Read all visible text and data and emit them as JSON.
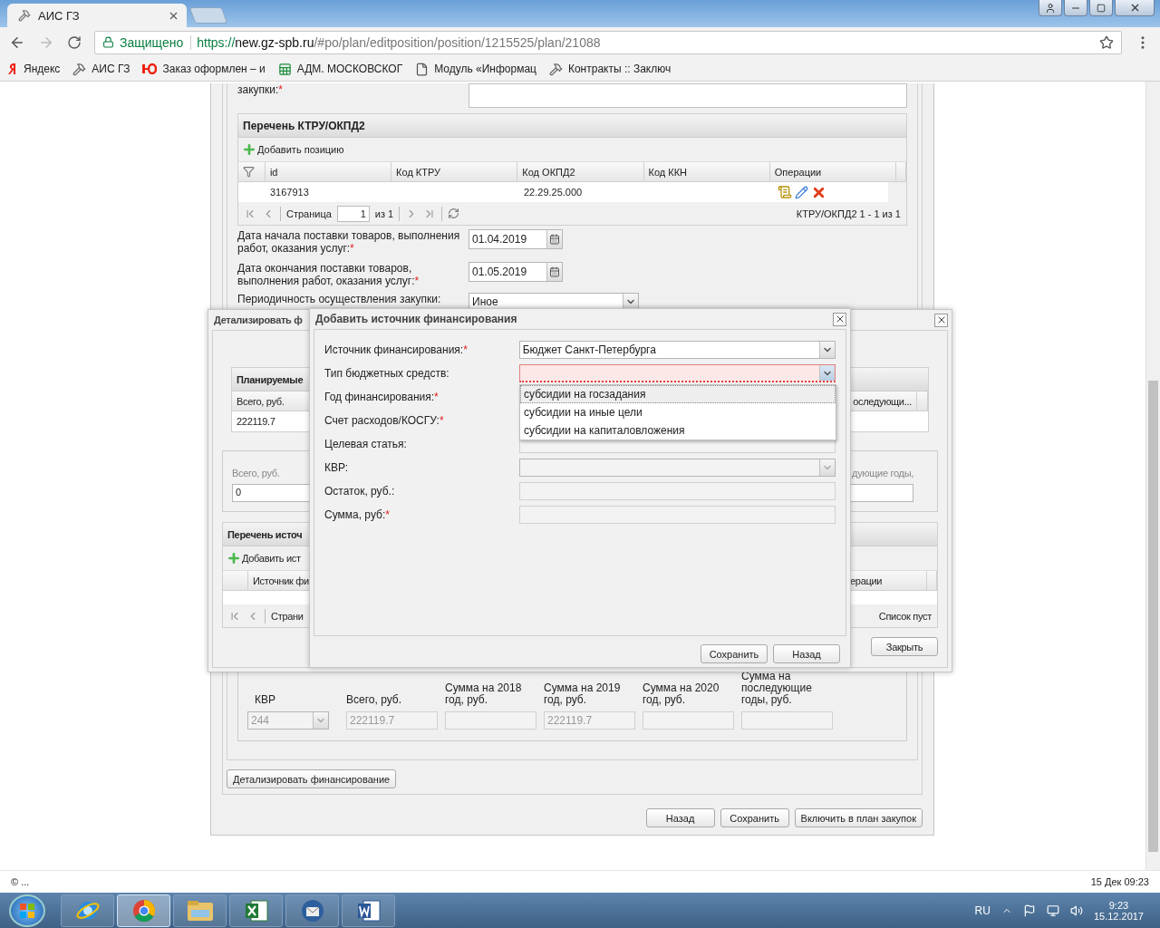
{
  "browser": {
    "tab": {
      "title": "АИС ГЗ"
    },
    "security": "Защищено",
    "url": {
      "scheme": "https://",
      "host": "new.gz-spb.ru",
      "path": "/#po/plan/editposition/position/1215525/plan/21088"
    },
    "bookmarks": [
      {
        "label": "Яндекс",
        "kind": "yandex"
      },
      {
        "label": "АИС ГЗ",
        "kind": "hammer"
      },
      {
        "label": "Заказ оформлен – и",
        "kind": "yu"
      },
      {
        "label": "АДМ. МОСКОВСКОГ",
        "kind": "sheet"
      },
      {
        "label": "Модуль «Информац",
        "kind": "doc"
      },
      {
        "label": "Контракты :: Заключ",
        "kind": "hammer"
      }
    ]
  },
  "form": {
    "purchase_field": {
      "label": "закупки:",
      "asterisk": "*"
    },
    "ktru_grid": {
      "title": "Перечень КТРУ/ОКПД2",
      "add_button": "Добавить позицию",
      "columns": [
        "id",
        "Код КТРУ",
        "Код ОКПД2",
        "Код ККН",
        "Операции"
      ],
      "rows": [
        {
          "id": "3167913",
          "okpd2": "22.29.25.000"
        }
      ],
      "pager": {
        "page_label": "Страница",
        "page": "1",
        "of": "из 1",
        "summary": "КТРУ/ОКПД2 1 - 1 из 1"
      }
    },
    "dates": [
      {
        "label": "Дата начала поставки товаров, выполнения работ, оказания услуг:",
        "asterisk": "*",
        "value": "01.04.2019"
      },
      {
        "label": "Дата окончания поставки товаров, выполнения работ, оказания услуг:",
        "asterisk": "*",
        "value": "01.05.2019"
      }
    ],
    "periodicity": {
      "label": "Периодичность осуществления закупки:",
      "value": "Иное"
    },
    "kvr_fields": [
      {
        "label": "КВР",
        "value": "244",
        "kind": "select",
        "disabled": true
      },
      {
        "label": "Всего, руб.",
        "value": "222119.7",
        "kind": "text",
        "disabled": true
      },
      {
        "label": "Сумма на 2018 год, руб.",
        "kind": "text",
        "disabled": true
      },
      {
        "label": "Сумма на 2019 год, руб.",
        "value": "222119.7",
        "kind": "text",
        "disabled": true
      },
      {
        "label": "Сумма на 2020 год, руб.",
        "kind": "text",
        "disabled": true
      },
      {
        "label": "Сумма на последующие годы, руб.",
        "kind": "text",
        "disabled": true
      }
    ],
    "detail_button": "Детализировать финансирование",
    "buttons": [
      "Назад",
      "Сохранить",
      "Включить в план закупок"
    ]
  },
  "detail_dialog": {
    "title": "Детализировать ф",
    "planned_grid": {
      "title": "Планируемые",
      "left_column": "Всего, руб.",
      "right_column": "оследующи...",
      "left_value": "222119.7"
    },
    "totals": {
      "left_label": "Всего, руб.",
      "left_value": "0",
      "right_label": "дующие годы,"
    },
    "sources_grid": {
      "title": "Перечень источ",
      "add_button": "Добавить ист",
      "left_column": "Источник фи",
      "right_column": "ерации",
      "pager_label": "Страни",
      "summary": "Список пуст"
    },
    "close_button": "Закрыть"
  },
  "source_dialog": {
    "title": "Добавить источник финансирования",
    "fields": [
      {
        "label": "Источник финансирования:",
        "asterisk": "*",
        "kind": "select",
        "value": "Бюджет Санкт-Петербурга",
        "invalid": false,
        "expanded": false,
        "disabled": false
      },
      {
        "label": "Тип бюджетных средств:",
        "kind": "select",
        "invalid": true,
        "expanded": true,
        "disabled": false,
        "options": [
          {
            "label": "субсидии на госзадания",
            "selected": true
          },
          {
            "label": "субсидии на иные цели",
            "selected": false
          },
          {
            "label": "субсидии на капиталовложения",
            "selected": false
          }
        ]
      },
      {
        "label": "Год финансирования:",
        "asterisk": "*",
        "kind": "select"
      },
      {
        "label": "Счет расходов/КОСГУ:",
        "asterisk": "*",
        "kind": "select"
      },
      {
        "label": "Целевая статья:",
        "kind": "text",
        "invalid": false,
        "disabled": true
      },
      {
        "label": "КВР:",
        "kind": "select",
        "invalid": false,
        "expanded": false,
        "disabled": true
      },
      {
        "label": "Остаток, руб.:",
        "kind": "text",
        "invalid": false,
        "disabled": true
      },
      {
        "label": "Сумма, руб:",
        "asterisk": "*",
        "kind": "text",
        "invalid": false,
        "disabled": true
      }
    ],
    "buttons": [
      "Сохранить",
      "Назад"
    ]
  },
  "status_bar": {
    "left": "© ...",
    "right": "15 Дек 09:23"
  },
  "taskbar": {
    "apps": [
      {
        "kind": "ie",
        "selected": false
      },
      {
        "kind": "chrome",
        "selected": true
      },
      {
        "kind": "explorer",
        "selected": false
      },
      {
        "kind": "excel",
        "selected": false
      },
      {
        "kind": "mail",
        "selected": false
      },
      {
        "kind": "word",
        "selected": false
      }
    ],
    "language": "RU",
    "time": "9:23",
    "date": "15.12.2017"
  }
}
